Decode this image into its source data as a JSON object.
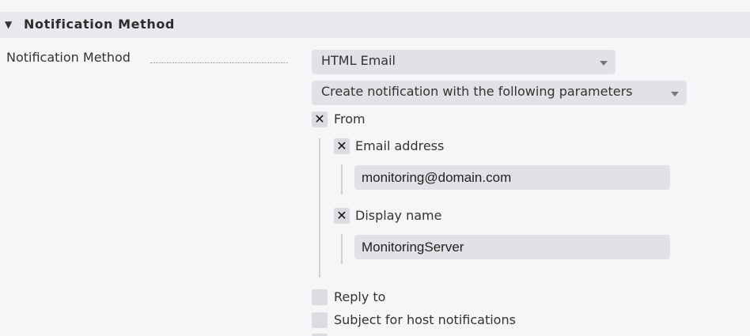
{
  "section": {
    "toggle_icon": "▼",
    "title": "Notification Method"
  },
  "field": {
    "label": "Notification Method"
  },
  "method_select": {
    "value": "HTML Email"
  },
  "params_select": {
    "value": "Create notification with the following parameters"
  },
  "from": {
    "label": "From",
    "checked": true,
    "email": {
      "label": "Email address",
      "checked": true,
      "value": "monitoring@domain.com"
    },
    "display_name": {
      "label": "Display name",
      "checked": true,
      "value": "MonitoringServer"
    }
  },
  "reply_to": {
    "label": "Reply to",
    "checked": false
  },
  "subject_host": {
    "label": "Subject for host notifications",
    "checked": false
  },
  "check_mark": "✕"
}
